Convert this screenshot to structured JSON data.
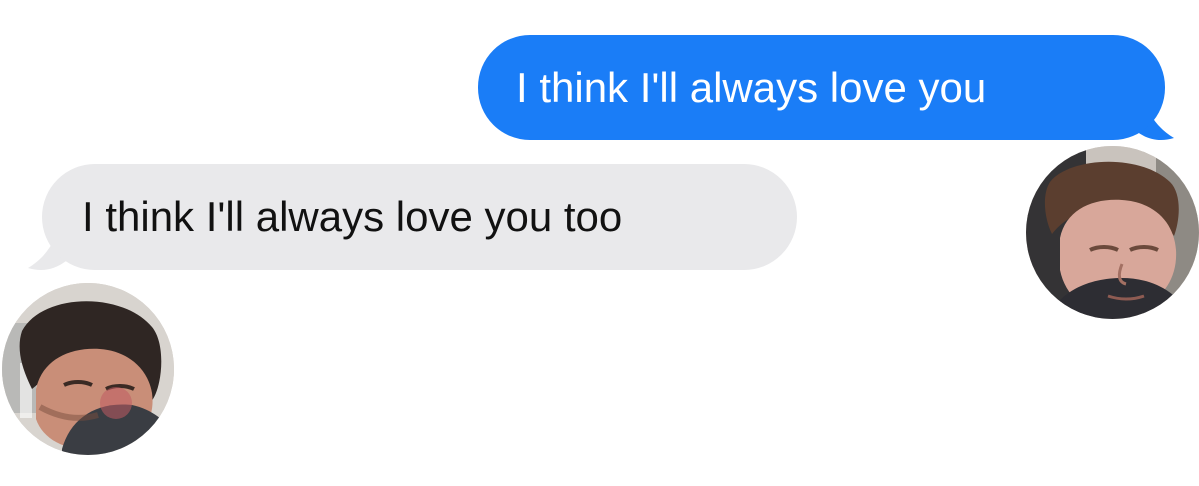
{
  "messages": [
    {
      "direction": "sent",
      "text": "I think I'll always love you",
      "bubble_color": "#1a7df7",
      "text_color": "#ffffff"
    },
    {
      "direction": "received",
      "text": "I think I'll always love you too",
      "bubble_color": "#e9e9eb",
      "text_color": "#111111"
    }
  ],
  "avatars": {
    "received": {
      "icon": "contact-avatar-icon"
    },
    "sent": {
      "icon": "contact-avatar-icon"
    }
  }
}
